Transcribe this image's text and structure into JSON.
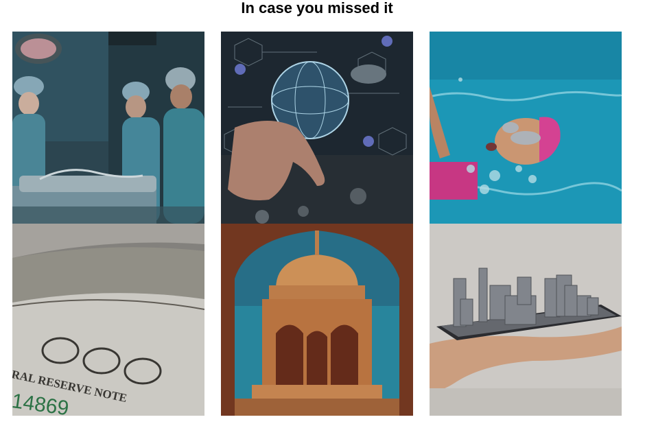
{
  "section": {
    "title": "In case you missed it"
  },
  "tiles": [
    {
      "subject": "surgeons operating in theatre"
    },
    {
      "subject": "hand touching digital globe network"
    },
    {
      "subject": "swimmer with pink cap and goggles"
    },
    {
      "subject": "us dollar banknotes",
      "banknote_text": "RAL RESERVE NOTE",
      "serial_text": "14869"
    },
    {
      "subject": "sandstone chhatri pavilion"
    },
    {
      "subject": "hand holding city model on tablet"
    }
  ]
}
